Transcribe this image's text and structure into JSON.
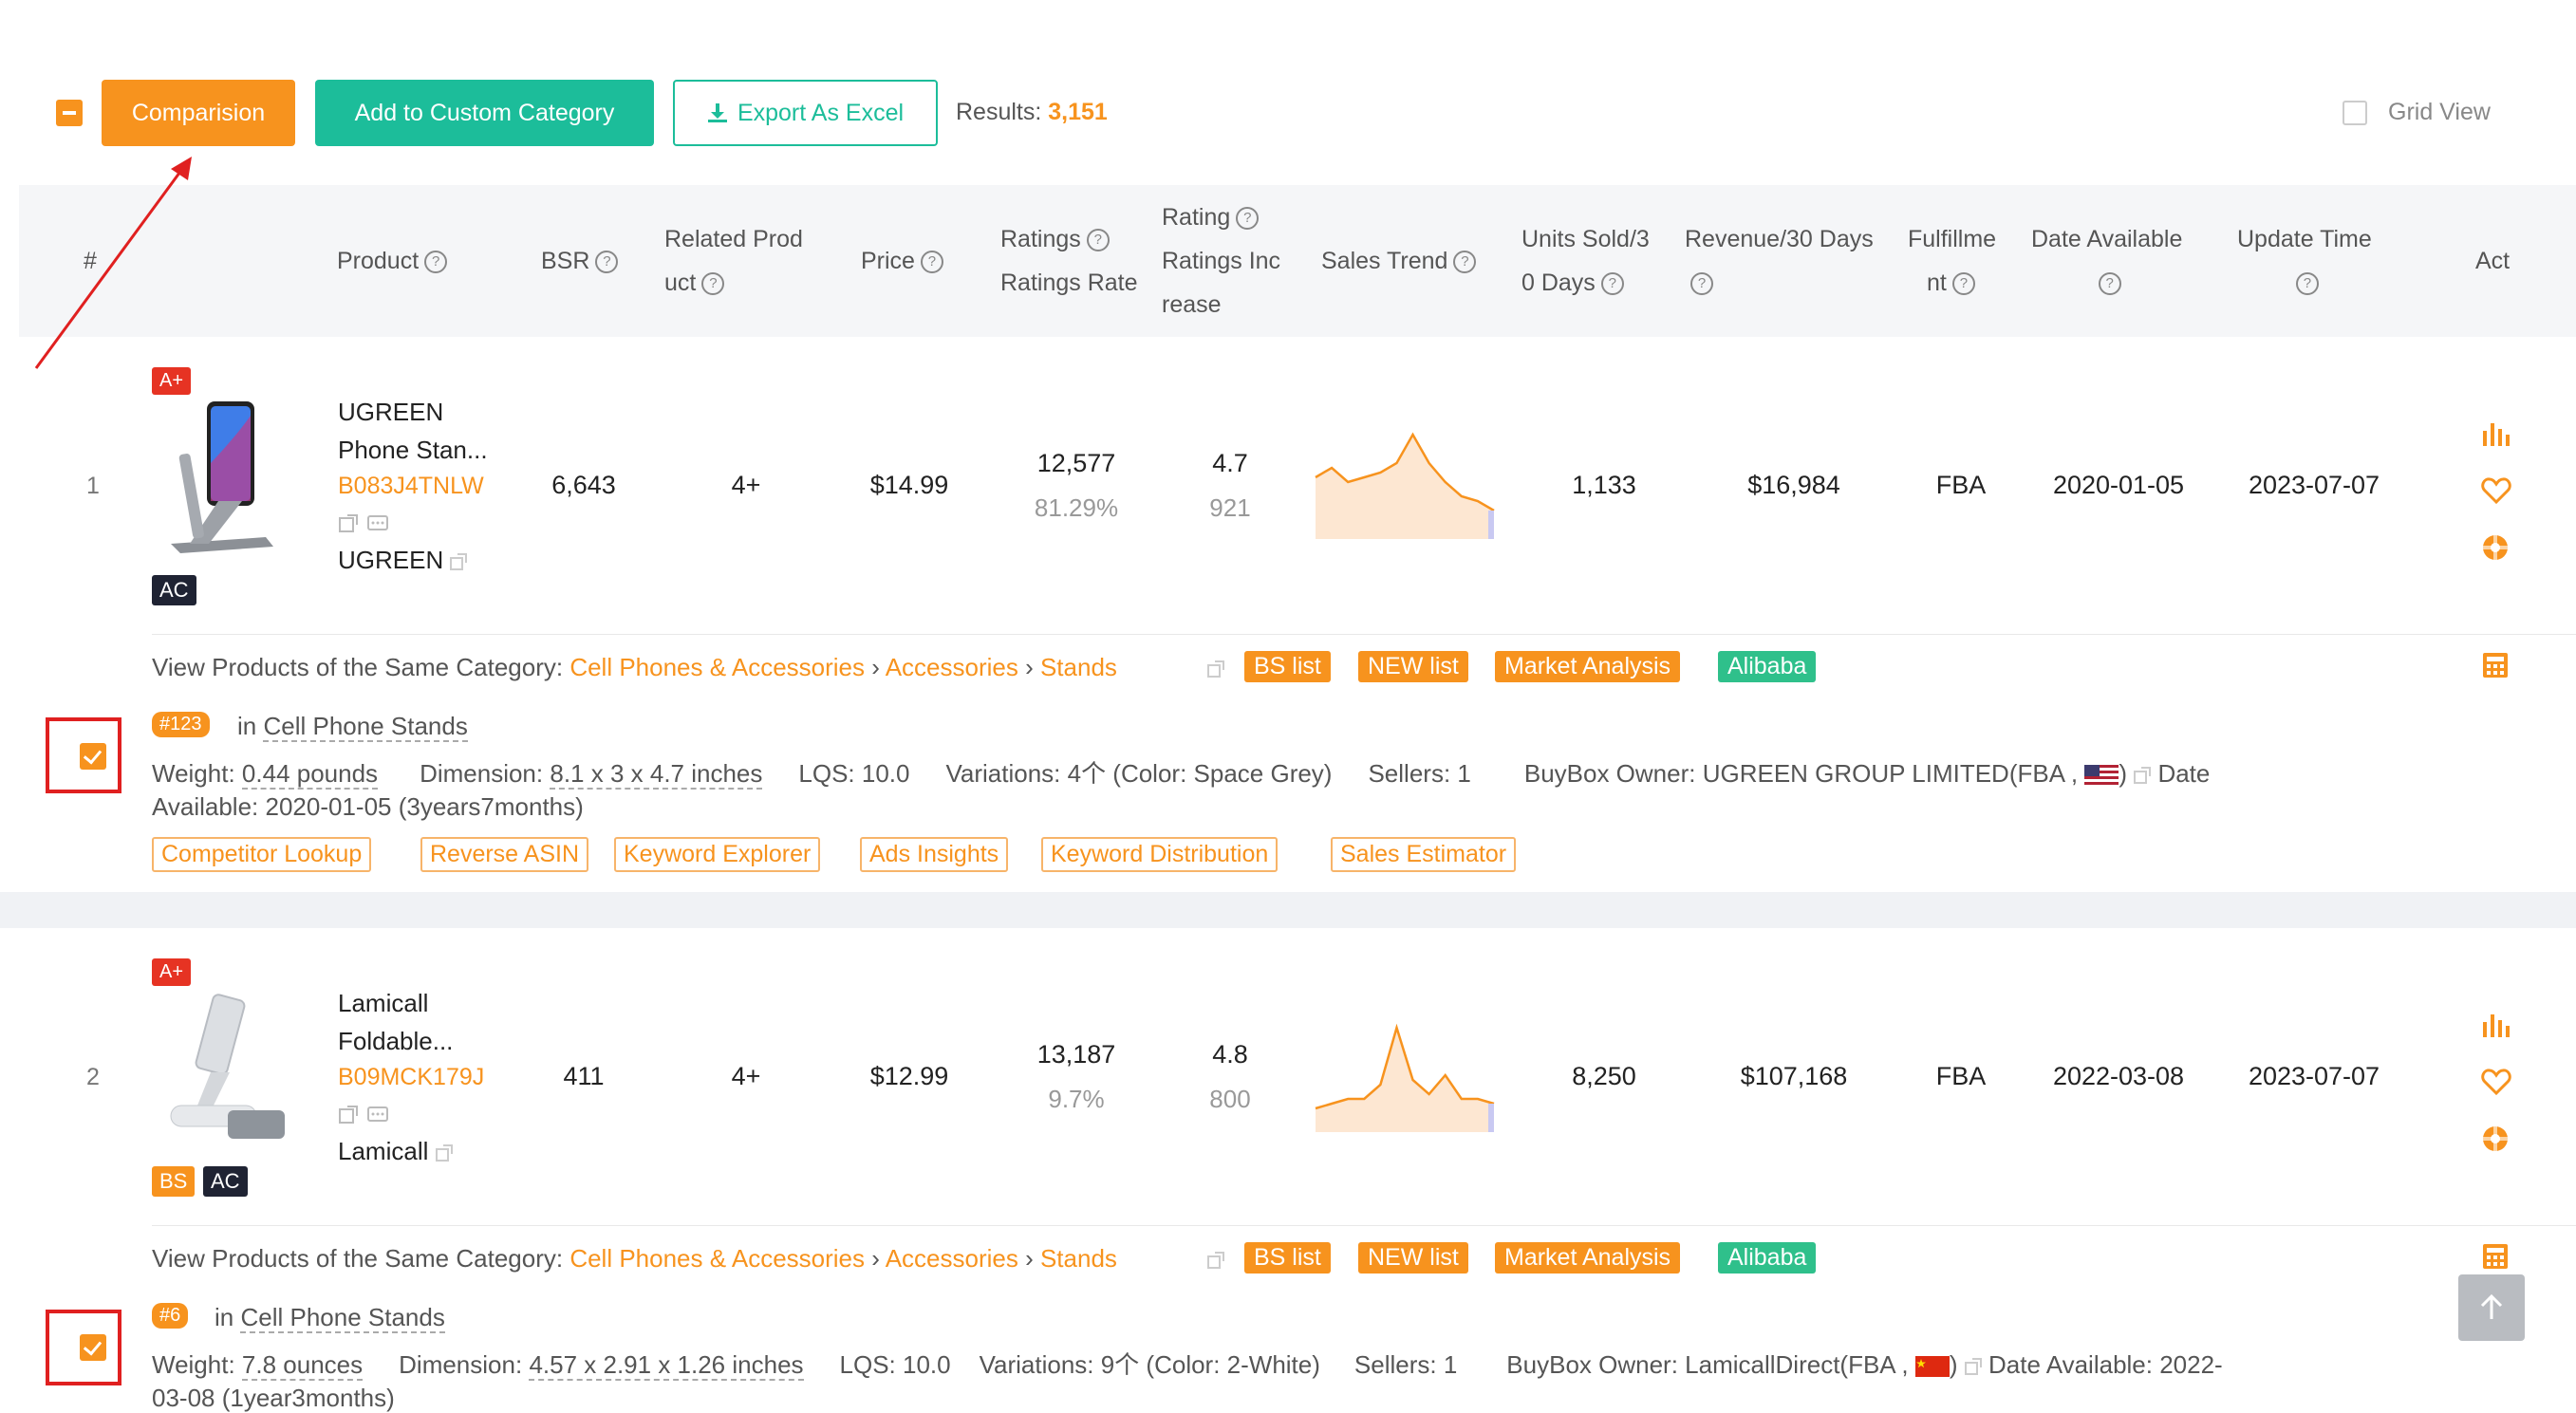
{
  "toolbar": {
    "comparision_label": "Comparision",
    "custom_category_label": "Add to Custom Category",
    "export_label": "Export As Excel",
    "results_label": "Results:",
    "results_count": "3,151",
    "grid_view_label": "Grid View"
  },
  "headers": {
    "index": "#",
    "product": "Product",
    "bsr": "BSR",
    "related_line1": "Related Prod",
    "related_line2": "uct",
    "price": "Price",
    "ratings_line1": "Ratings",
    "ratings_line2": "Ratings Rate",
    "rating_line1": "Rating",
    "rating_line2": "Ratings Inc",
    "rating_line3": "rease",
    "sales_trend": "Sales Trend",
    "units_line1": "Units Sold/3",
    "units_line2": "0 Days",
    "revenue": "Revenue/30 Days",
    "fulfill_line1": "Fulfillme",
    "fulfill_line2": "nt",
    "date_available": "Date Available",
    "update_time": "Update Time",
    "act": "Act"
  },
  "products": [
    {
      "index": "1",
      "badge_aplus": "A+",
      "badge_ac": "AC",
      "name_line1": "UGREEN",
      "name_line2": "Phone Stan...",
      "asin": "B083J4TNLW",
      "brand": "UGREEN",
      "bsr": "6,643",
      "related": "4+",
      "price": "$14.99",
      "ratings": "12,577",
      "ratings_rate": "81.29%",
      "rating": "4.7",
      "ratings_increase": "921",
      "units_sold": "1,133",
      "revenue": "$16,984",
      "fulfillment": "FBA",
      "date_available": "2020-01-05",
      "update_time": "2023-07-07",
      "category_prefix": "View Products of the Same Category:",
      "category_path": [
        "Cell Phones & Accessories",
        "Accessories",
        "Stands"
      ],
      "tags": [
        "BS list",
        "NEW list",
        "Market Analysis",
        "Alibaba"
      ],
      "rank": "#123",
      "in_label": "in",
      "rank_category": "Cell Phone Stands",
      "weight_label": "Weight:",
      "weight": "0.44 pounds",
      "dimension_label": "Dimension:",
      "dimension": "8.1 x 3 x 4.7 inches",
      "lqs": "LQS: 10.0",
      "variations": "Variations: 4个 (Color: Space Grey)",
      "sellers": "Sellers: 1",
      "buybox": "BuyBox Owner: UGREEN GROUP LIMITED(FBA ,",
      "date_label": "Date",
      "available_line": "Available: 2020-01-05 (3years7months)",
      "tools": [
        "Competitor Lookup",
        "Reverse ASIN",
        "Keyword Explorer",
        "Ads Insights",
        "Keyword Distribution",
        "Sales Estimator"
      ],
      "trend": [
        0.45,
        0.35,
        0.5,
        0.45,
        0.4,
        0.3,
        0.0,
        0.3,
        0.5,
        0.65,
        0.7,
        0.8
      ]
    },
    {
      "index": "2",
      "badge_aplus": "A+",
      "badge_bs": "BS",
      "badge_ac": "AC",
      "name_line1": "Lamicall",
      "name_line2": "Foldable...",
      "asin": "B09MCK179J",
      "brand": "Lamicall",
      "bsr": "411",
      "related": "4+",
      "price": "$12.99",
      "ratings": "13,187",
      "ratings_rate": "9.7%",
      "rating": "4.8",
      "ratings_increase": "800",
      "units_sold": "8,250",
      "revenue": "$107,168",
      "fulfillment": "FBA",
      "date_available": "2022-03-08",
      "update_time": "2023-07-07",
      "category_prefix": "View Products of the Same Category:",
      "category_path": [
        "Cell Phones & Accessories",
        "Accessories",
        "Stands"
      ],
      "tags": [
        "BS list",
        "NEW list",
        "Market Analysis",
        "Alibaba"
      ],
      "rank": "#6",
      "in_label": "in",
      "rank_category": "Cell Phone Stands",
      "weight_label": "Weight:",
      "weight": "7.8 ounces",
      "dimension_label": "Dimension:",
      "dimension": "4.57 x 2.91 x 1.26 inches",
      "lqs": "LQS: 10.0",
      "variations": "Variations: 9个 (Color: 2-White)",
      "sellers": "Sellers: 1",
      "buybox": "BuyBox Owner: LamicallDirect(FBA ,",
      "date_label": "Date Available: 2022-",
      "available_line": "03-08 (1year3months)",
      "trend": [
        0.85,
        0.8,
        0.75,
        0.75,
        0.6,
        0.0,
        0.55,
        0.7,
        0.5,
        0.75,
        0.75,
        0.8
      ]
    }
  ],
  "colors": {
    "orange": "#f7931e",
    "teal": "#1cbd9a",
    "green_tag": "#2fc08b",
    "red_badge": "#e63323",
    "annotation_red": "#e02020"
  }
}
